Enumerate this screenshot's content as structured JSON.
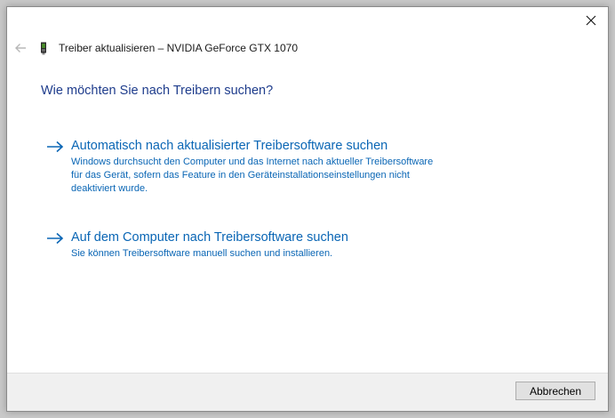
{
  "window": {
    "title": "Treiber aktualisieren – NVIDIA GeForce GTX 1070"
  },
  "icons": {
    "close": "close-icon",
    "back": "back-arrow-icon",
    "device": "graphics-card-icon",
    "option_arrow": "right-arrow-icon"
  },
  "colors": {
    "question": "#1e3c8c",
    "link": "#0a66b5",
    "footer_bg": "#f0f0f0"
  },
  "main": {
    "question": "Wie möchten Sie nach Treibern suchen?",
    "options": [
      {
        "title": "Automatisch nach aktualisierter Treibersoftware suchen",
        "description": "Windows durchsucht den Computer und das Internet nach aktueller Treibersoftware für das Gerät, sofern das Feature in den Geräteinstallationseinstellungen nicht deaktiviert wurde."
      },
      {
        "title": "Auf dem Computer nach Treibersoftware suchen",
        "description": "Sie können Treibersoftware manuell suchen und installieren."
      }
    ]
  },
  "footer": {
    "cancel_label": "Abbrechen"
  }
}
